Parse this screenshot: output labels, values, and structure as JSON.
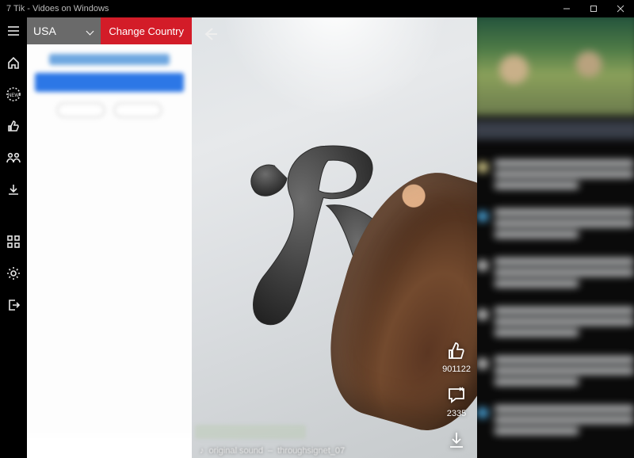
{
  "window": {
    "title": "7 Tik - Vidoes on Windows"
  },
  "sidebar": {
    "items": [
      {
        "name": "menu-icon"
      },
      {
        "name": "home-icon"
      },
      {
        "name": "new-badge-icon"
      },
      {
        "name": "like-icon"
      },
      {
        "name": "group-icon"
      },
      {
        "name": "download-icon"
      },
      {
        "name": "apps-icon"
      },
      {
        "name": "settings-icon"
      },
      {
        "name": "logout-icon"
      }
    ]
  },
  "left_header": {
    "country_selected": "USA",
    "change_label": "Change Country"
  },
  "video": {
    "likes": "901122",
    "comments": "2335",
    "sound_prefix": "♪",
    "sound_label": "original sound",
    "sound_user": "throughsignet_07"
  },
  "right_panel": {
    "comments": [
      {
        "color": "#d9ce8c"
      },
      {
        "color": "#4aa4da"
      },
      {
        "color": "#c7c7c7"
      },
      {
        "color": "#c7c7c7"
      },
      {
        "color": "#c7c7c7"
      },
      {
        "color": "#4aa4da"
      }
    ]
  }
}
